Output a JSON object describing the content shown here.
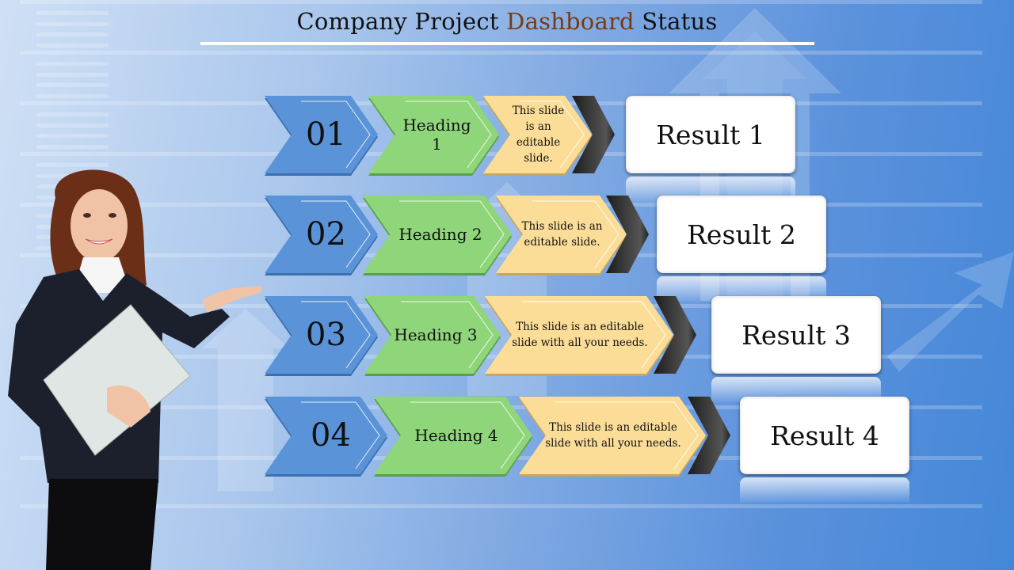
{
  "slide": {
    "title_prefix": "Company Project ",
    "title_accent": "Dashboard",
    "title_suffix": " Status",
    "colors": {
      "title_accent": "#7a3a10",
      "number_chevron": "#5a93d8",
      "heading_chevron": "#8fd57a",
      "description_chevron": "#fbdd98",
      "connector_chevron": "#2a2a2a",
      "result_box": "#ffffff"
    }
  },
  "rows": [
    {
      "number": "01",
      "heading": "Heading 1",
      "description_line1": "This slide is an",
      "description_line2": "editable  slide.",
      "result": "Result 1"
    },
    {
      "number": "02",
      "heading": "Heading 2",
      "description_line1": "This slide is an",
      "description_line2": "editable slide.",
      "result": "Result 2"
    },
    {
      "number": "03",
      "heading": "Heading 3",
      "description_line1": "This slide is an editable",
      "description_line2": "slide with all your needs.",
      "result": "Result 3"
    },
    {
      "number": "04",
      "heading": "Heading 4",
      "description_line1": "This slide is an editable",
      "description_line2": "slide with all your needs.",
      "result": "Result 4"
    }
  ],
  "illustration": {
    "presenter": "businesswoman-presenting",
    "background_motif": "growth-arrows-and-bars"
  }
}
